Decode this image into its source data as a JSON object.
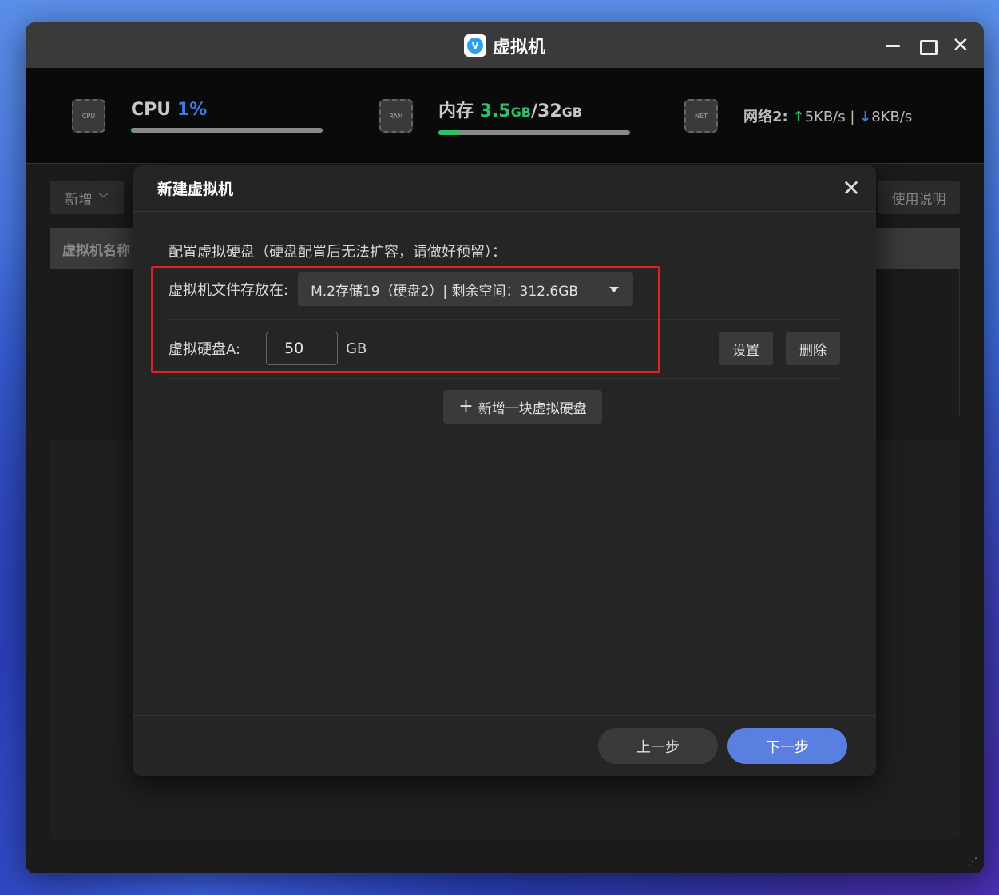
{
  "window": {
    "title": "虚拟机",
    "logo_letter": "V",
    "controls": {
      "minimize_icon": "minimize-icon",
      "maximize_icon": "maximize-icon",
      "close_glyph": "✕"
    }
  },
  "stats": {
    "cpu": {
      "chip_text": "CPU",
      "label": "CPU",
      "value": "1%",
      "usage_fraction": 0.01
    },
    "memory": {
      "chip_text": "RAM",
      "label": "内存",
      "used": "3.5",
      "used_unit": "GB",
      "sep": "/",
      "total": "32",
      "total_unit": "GB",
      "usage_fraction": 0.11
    },
    "network": {
      "chip_text": "NET",
      "label": "网络2:",
      "up_arrow": "↑",
      "up": "5KB/s",
      "sep": "|",
      "down_arrow": "↓",
      "down": "8KB/s"
    }
  },
  "toolbar": {
    "add_label": "新增",
    "add_caret": "﹀",
    "help_label": "使用说明"
  },
  "table": {
    "col_name": "虚拟机名称"
  },
  "dialog": {
    "title": "新建虚拟机",
    "close_glyph": "✕",
    "section_label": "配置虚拟硬盘（硬盘配置后无法扩容，请做好预留）：",
    "storage_label": "虚拟机文件存放在:",
    "storage_value": "M.2存储19（硬盘2）| 剩余空间：312.6GB",
    "disk_label": "虚拟硬盘A:",
    "disk_size": "50",
    "disk_unit": "GB",
    "settings_label": "设置",
    "delete_label": "删除",
    "add_disk_plus": "+",
    "add_disk_label": "新增一块虚拟硬盘",
    "prev_label": "上一步",
    "next_label": "下一步"
  },
  "colors": {
    "accent": "#5b7fe0",
    "highlight": "#e0202a",
    "green": "#2fc06c",
    "blue": "#3a7ee0"
  }
}
